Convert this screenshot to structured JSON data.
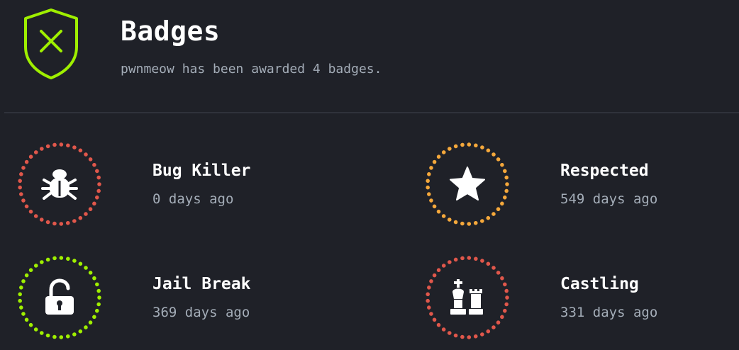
{
  "header": {
    "title": "Badges",
    "subtitle": "pwnmeow has been awarded 4 badges.",
    "icon": "shield-x-icon",
    "accent": "#9fef00"
  },
  "badges": [
    {
      "name": "Bug Killer",
      "awarded": "0 days ago",
      "icon": "bug-icon",
      "ring_color": "#e0574b"
    },
    {
      "name": "Respected",
      "awarded": "549 days ago",
      "icon": "star-icon",
      "ring_color": "#f5a83b"
    },
    {
      "name": "Jail Break",
      "awarded": "369 days ago",
      "icon": "unlock-icon",
      "ring_color": "#9fef00"
    },
    {
      "name": "Castling",
      "awarded": "331 days ago",
      "icon": "chess-icon",
      "ring_color": "#e0574b"
    }
  ]
}
